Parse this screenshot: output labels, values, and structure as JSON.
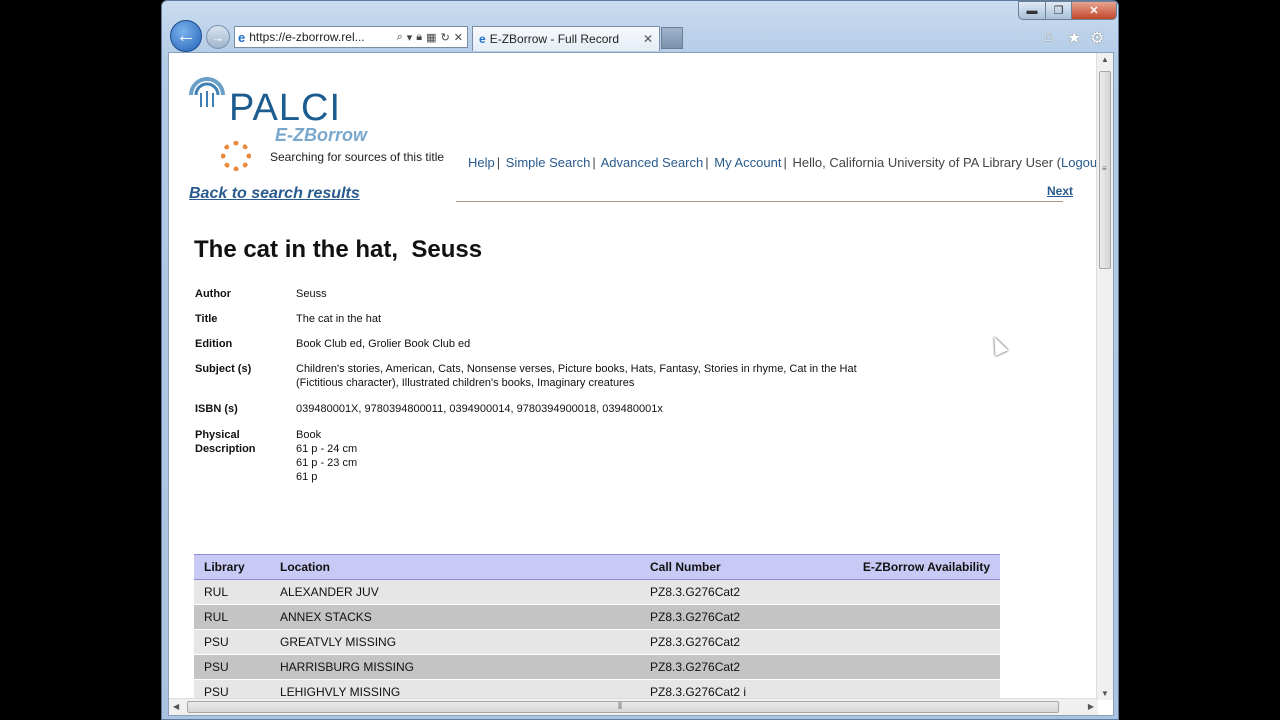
{
  "browser": {
    "url": "https://e-zborrow.rel...",
    "tab_title": "E-ZBorrow - Full Record",
    "minimize_glyph": "▬",
    "maximize_glyph": "❐",
    "close_glyph": "✕"
  },
  "header": {
    "logo_text": "PALCI",
    "logo_subtext": "E-ZBorrow",
    "searching_text": "Searching for sources of this title",
    "nav": {
      "help": "Help",
      "simple_search": "Simple Search",
      "advanced_search": "Advanced Search",
      "my_account": "My Account",
      "greeting": "Hello, California University of PA Library User (",
      "logout": "Logout",
      "greeting_end": ")"
    },
    "back_link": "Back to search results",
    "next_link": "Next"
  },
  "record": {
    "title": "The cat in the hat,  Seuss",
    "fields": [
      {
        "label": "Author",
        "value": "Seuss"
      },
      {
        "label": "Title",
        "value": "The cat in the hat"
      },
      {
        "label": "Edition",
        "value": "Book Club ed, Grolier Book Club ed"
      },
      {
        "label": "Subject (s)",
        "value": "Children's stories, American, Cats, Nonsense verses, Picture books, Hats, Fantasy, Stories in rhyme, Cat in the Hat (Fictitious character), Illustrated children's books, Imaginary creatures"
      },
      {
        "label": "ISBN (s)",
        "value": "039480001X, 9780394800011, 0394900014, 9780394900018, 039480001x"
      },
      {
        "label": "Physical Description",
        "value_lines": [
          "Book",
          "61 p - 24 cm",
          "61 p - 23 cm",
          "61 p"
        ]
      }
    ]
  },
  "holdings": {
    "headers": [
      "Library",
      "Location",
      "Call Number",
      "E-ZBorrow Availability"
    ],
    "rows": [
      [
        "RUL",
        "ALEXANDER JUV",
        "PZ8.3.G276Cat2",
        ""
      ],
      [
        "RUL",
        "ANNEX STACKS",
        "PZ8.3.G276Cat2",
        ""
      ],
      [
        "PSU",
        "GREATVLY MISSING",
        "PZ8.3.G276Cat2",
        ""
      ],
      [
        "PSU",
        "HARRISBURG MISSING",
        "PZ8.3.G276Cat2",
        ""
      ],
      [
        "PSU",
        "LEHIGHVLY MISSING",
        "PZ8.3.G276Cat2 i",
        ""
      ]
    ]
  },
  "colors": {
    "link": "#2a5b8e",
    "table_header": "#c9c9f5",
    "row_light": "#e6e6e6",
    "row_dark": "#c4c4c4"
  }
}
